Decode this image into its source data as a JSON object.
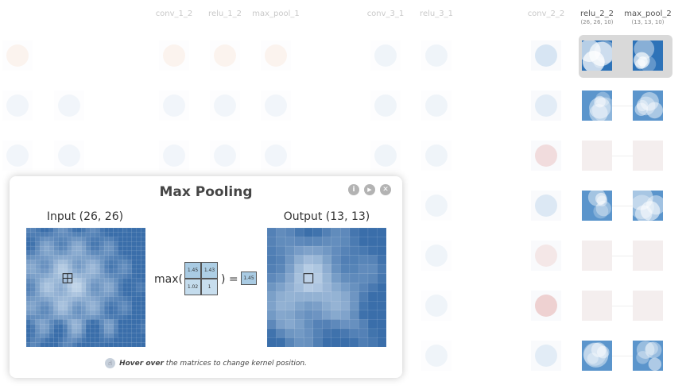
{
  "network": {
    "layers": [
      {
        "name": "",
        "dims": ""
      },
      {
        "name": "",
        "dims": ""
      },
      {
        "name": "conv_1_2",
        "dims": ""
      },
      {
        "name": "relu_1_2",
        "dims": ""
      },
      {
        "name": "max_pool_1",
        "dims": ""
      },
      {
        "name": "conv_3_1",
        "dims": ""
      },
      {
        "name": "relu_3_1",
        "dims": ""
      },
      {
        "name": "conv_2_2",
        "dims": ""
      },
      {
        "name": "relu_2_2",
        "dims": "(26, 26, 10)"
      },
      {
        "name": "max_pool_2",
        "dims": "(13, 13, 10)"
      }
    ]
  },
  "modal": {
    "title": "Max Pooling",
    "info_icon": "i",
    "play_icon": "▶",
    "close_icon": "✕",
    "input_label": "Input (26, 26)",
    "output_label": "Output (13, 13)",
    "formula_prefix": "max(",
    "formula_mid": ") =",
    "kernel_values": [
      "1.45",
      "1.43",
      "1.02",
      "1"
    ],
    "result_value": "1.45",
    "hint_bold": "Hover over",
    "hint_rest": " the matrices to change kernel position.",
    "colors": {
      "matrix_base": "#4a7fb8",
      "matrix_light": "#dbe9f5"
    }
  }
}
